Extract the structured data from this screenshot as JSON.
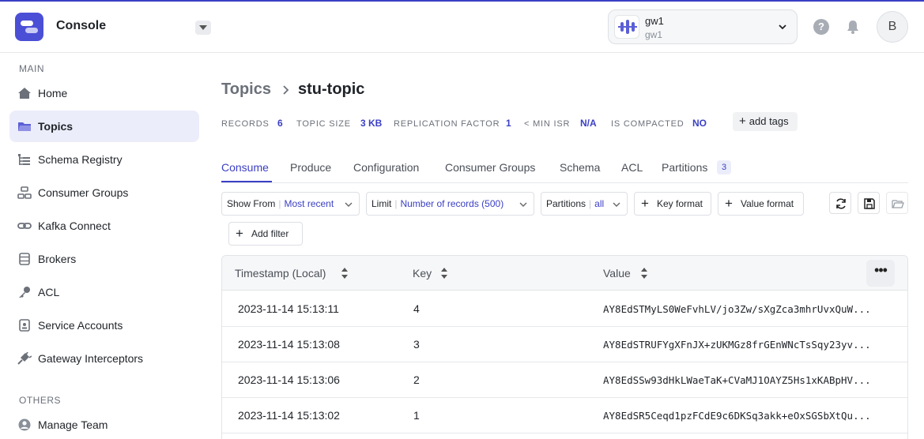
{
  "app": {
    "title": "Console"
  },
  "gateway": {
    "name": "gw1",
    "sub": "gw1"
  },
  "user": {
    "initial": "B"
  },
  "help_label": "?",
  "sidebar": {
    "main_label": "MAIN",
    "items": [
      {
        "label": "Home",
        "icon": "home-icon"
      },
      {
        "label": "Topics",
        "icon": "folder-icon",
        "active": true
      },
      {
        "label": "Schema Registry",
        "icon": "tree-icon"
      },
      {
        "label": "Consumer Groups",
        "icon": "groups-icon"
      },
      {
        "label": "Kafka Connect",
        "icon": "link-icon"
      },
      {
        "label": "Brokers",
        "icon": "database-icon"
      },
      {
        "label": "ACL",
        "icon": "key-icon"
      },
      {
        "label": "Service Accounts",
        "icon": "id-card-icon"
      },
      {
        "label": "Gateway Interceptors",
        "icon": "plug-icon"
      }
    ],
    "others_label": "OTHERS",
    "others": [
      {
        "label": "Manage Team",
        "icon": "user-circle-icon"
      }
    ]
  },
  "breadcrumb": {
    "root": "Topics",
    "current": "stu-topic"
  },
  "stats": [
    {
      "label": "RECORDS",
      "value": "6"
    },
    {
      "label": "TOPIC SIZE",
      "value": "3 KB"
    },
    {
      "label": "REPLICATION FACTOR",
      "value": "1"
    },
    {
      "label": "< MIN ISR",
      "value": "N/A"
    },
    {
      "label": "IS COMPACTED",
      "value": "NO"
    }
  ],
  "add_tags_label": "add tags",
  "tabs": [
    "Consume",
    "Produce",
    "Configuration",
    "Consumer Groups",
    "Schema",
    "ACL",
    "Partitions"
  ],
  "partitions_count": "3",
  "filters": {
    "show_from": {
      "key": "Show From",
      "value": "Most recent"
    },
    "limit": {
      "key": "Limit",
      "value": "Number of records (500)"
    },
    "partitions": {
      "key": "Partitions",
      "value": "all"
    },
    "key_format": "Key format",
    "value_format": "Value format",
    "add_filter": "Add filter"
  },
  "table": {
    "columns": [
      "Timestamp (Local)",
      "Key",
      "Value"
    ],
    "more_label": "•••",
    "rows": [
      {
        "timestamp": "2023-11-14 15:13:11",
        "key": "4",
        "value": "AY8EdSTMyLS0WeFvhLV/jo3Zw/sXgZca3mhrUvxQuW..."
      },
      {
        "timestamp": "2023-11-14 15:13:08",
        "key": "3",
        "value": "AY8EdSTRUFYgXFnJX+zUKMGz8frGEnWNcTsSqy23yv..."
      },
      {
        "timestamp": "2023-11-14 15:13:06",
        "key": "2",
        "value": "AY8EdSSw93dHkLWaeTaK+CVaMJ1OAYZ5Hs1xKABpHV..."
      },
      {
        "timestamp": "2023-11-14 15:13:02",
        "key": "1",
        "value": "AY8EdSR5Ceqd1pzFCdE9c6DKSq3akk+eOxSGSbXtQu..."
      }
    ]
  }
}
